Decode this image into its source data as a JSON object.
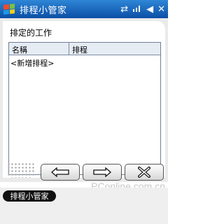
{
  "window": {
    "title": "排程小管家"
  },
  "status_icons": [
    "sync-icon",
    "signal-icon",
    "volume-icon",
    "close-icon"
  ],
  "header": {
    "label": "排定的工作"
  },
  "list": {
    "columns": [
      "名稱",
      "排程"
    ],
    "rows": [
      {
        "name": "<新增排程>"
      }
    ]
  },
  "toolbar": {
    "buttons": [
      "back-arrow-icon",
      "forward-arrow-icon",
      "delete-x-icon"
    ]
  },
  "watermark": "PConline.com.cn",
  "taskbar": {
    "app_tab": "排程小管家"
  },
  "colors": {
    "titlebar": "#1f6fc5",
    "header_bg": "#e6ecf4"
  }
}
